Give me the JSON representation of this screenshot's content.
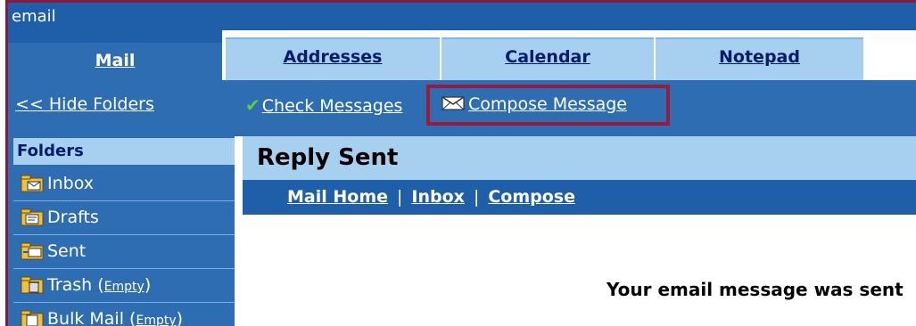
{
  "window": {
    "title": "email"
  },
  "tabs": [
    {
      "label": "Mail",
      "active": true
    },
    {
      "label": "Addresses",
      "active": false
    },
    {
      "label": "Calendar",
      "active": false
    },
    {
      "label": "Notepad",
      "active": false
    }
  ],
  "toolbar": {
    "hide_folders_label": "<< Hide Folders",
    "check_messages_label": "Check Messages",
    "compose_message_label": "Compose Message"
  },
  "sidebar": {
    "header": "Folders",
    "items": [
      {
        "label": "Inbox",
        "icon": "inbox-folder-icon"
      },
      {
        "label": "Drafts",
        "icon": "drafts-folder-icon"
      },
      {
        "label": "Sent",
        "icon": "sent-folder-icon"
      },
      {
        "label": "Trash",
        "empty_label": "Empty",
        "icon": "trash-folder-icon"
      },
      {
        "label": "Bulk Mail",
        "empty_label": "Empty",
        "icon": "bulk-mail-folder-icon"
      }
    ]
  },
  "main": {
    "title": "Reply Sent",
    "subnav": {
      "home": "Mail Home",
      "inbox": "Inbox",
      "compose": "Compose",
      "separator": "|"
    },
    "message": "Your email message was sent"
  },
  "colors": {
    "primary_blue": "#1f5ea8",
    "mid_blue": "#2f6db3",
    "light_blue": "#a7cff0",
    "highlight": "#9a1b3d",
    "check_green": "#5cd13f"
  }
}
